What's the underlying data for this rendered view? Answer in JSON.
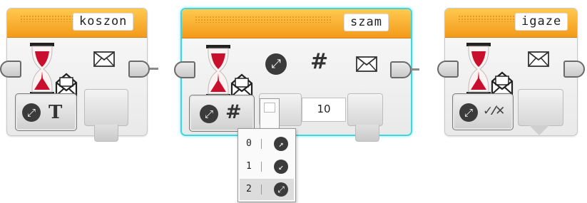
{
  "blocks": [
    {
      "name": "koszon",
      "label": "koszon",
      "mode_glyph": "T",
      "icons": [
        "hourglass-wait-icon",
        "envelope-receive-icon",
        "envelope-icon",
        "compare-mode-icon",
        "text-type-icon"
      ]
    },
    {
      "name": "szam",
      "label": "szam",
      "mode_glyph": "#",
      "compare_glyph": "#",
      "value": "10",
      "popup_selected_preview": "2",
      "icons": [
        "hourglass-wait-icon",
        "envelope-receive-icon",
        "compare-icon",
        "number-icon",
        "envelope-icon",
        "compare-mode-icon",
        "number-type-icon"
      ]
    },
    {
      "name": "igaze",
      "label": "igaze",
      "mode_glyph": "✓⁄✕",
      "icons": [
        "hourglass-wait-icon",
        "envelope-receive-icon",
        "envelope-icon",
        "compare-mode-icon",
        "logic-type-icon"
      ]
    }
  ],
  "popup": {
    "options": [
      {
        "num": "0",
        "icon": "compare-arrow-up-icon"
      },
      {
        "num": "1",
        "icon": "compare-arrow-down-icon"
      },
      {
        "num": "2",
        "icon": "compare-arrow-both-icon"
      }
    ],
    "selected_index": 2
  }
}
